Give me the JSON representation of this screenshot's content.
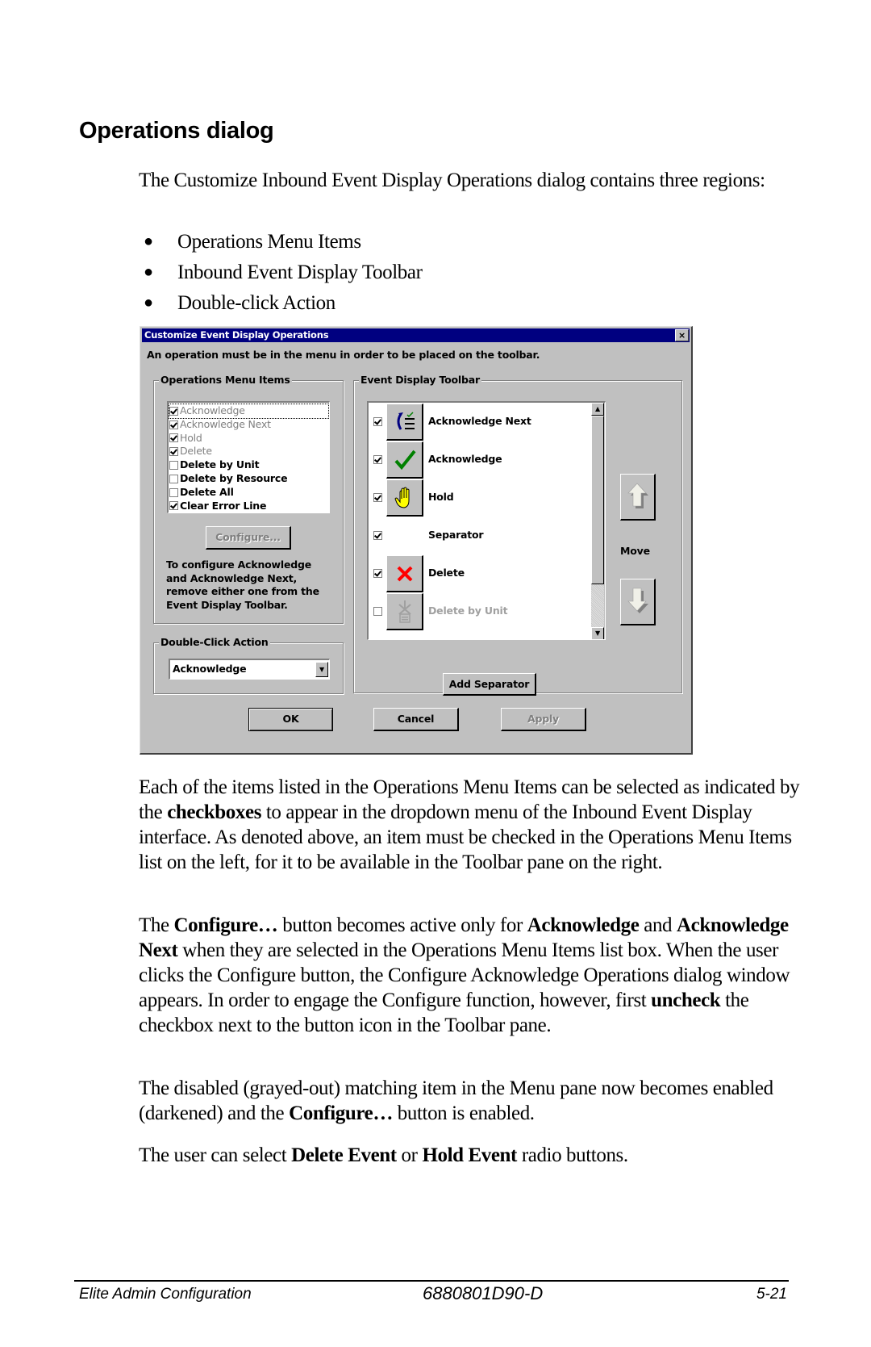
{
  "heading": "Operations dialog",
  "intro": "The Customize Inbound Event Display Operations dialog contains three regions:",
  "bullets": [
    "Operations Menu Items",
    "Inbound Event Display Toolbar",
    "Double-click Action"
  ],
  "dialog": {
    "title": "Customize Event Display Operations",
    "close_label": "×",
    "instruction": "An operation must be in the menu in order to be placed on the toolbar.",
    "menu_group": {
      "label": "Operations Menu Items",
      "items": [
        {
          "label": "Acknowledge",
          "checked": true,
          "grayed": true,
          "focused": true
        },
        {
          "label": "Acknowledge Next",
          "checked": true,
          "grayed": true
        },
        {
          "label": "Hold",
          "checked": true,
          "grayed": true
        },
        {
          "label": "Delete",
          "checked": true,
          "grayed": true
        },
        {
          "label": "Delete by Unit",
          "checked": false,
          "grayed": false
        },
        {
          "label": "Delete by Resource",
          "checked": false,
          "grayed": false
        },
        {
          "label": "Delete All",
          "checked": false,
          "grayed": false
        },
        {
          "label": "Clear Error Line",
          "checked": true,
          "grayed": false
        }
      ],
      "configure_button": "Configure...",
      "configure_enabled": false,
      "note": "To configure Acknowledge and Acknowledge Next, remove either one from the Event Display Toolbar."
    },
    "double_click_group": {
      "label": "Double-Click Action",
      "selected": "Acknowledge"
    },
    "toolbar_group": {
      "label": "Event Display Toolbar",
      "items": [
        {
          "label": "Acknowledge Next",
          "checked": true,
          "icon": "acknowledge-next-icon",
          "disabled": false
        },
        {
          "label": "Acknowledge",
          "checked": true,
          "icon": "green-checkmark-icon",
          "disabled": false
        },
        {
          "label": "Hold",
          "checked": true,
          "icon": "yellow-hand-icon",
          "disabled": false
        },
        {
          "label": "Separator",
          "checked": true,
          "icon": null,
          "disabled": false
        },
        {
          "label": "Delete",
          "checked": true,
          "icon": "red-x-icon",
          "disabled": false
        },
        {
          "label": "Delete by Unit",
          "checked": false,
          "icon": "delete-by-unit-icon",
          "disabled": true
        }
      ],
      "add_separator_button": "Add Separator",
      "move_label": "Move"
    },
    "buttons": {
      "ok": "OK",
      "cancel": "Cancel",
      "apply": "Apply"
    },
    "colors": {
      "titlebar": "#000080",
      "face": "#c0c0c0",
      "check_green": "#008000",
      "delete_red": "#ff0000",
      "hold_yellow": "#ffff00"
    }
  },
  "body": {
    "p1": {
      "t1": "Each of the items listed in the Operations Menu Items can be selected as indicated by the ",
      "b1": "checkboxes",
      "t2": " to appear in the dropdown menu of the Inbound Event Display interface.  As denoted above, an item must be checked in the Operations Menu Items list on the left, for it to be available in the Toolbar pane on the right."
    },
    "p2": {
      "t1": "The ",
      "b1": "Configure…",
      "t2": " button becomes active only for ",
      "b2": "Acknowledge",
      "t3": " and ",
      "b3": "Acknowledge Next",
      "t4": " when they are selected in the Operations Menu Items list box.  When the user clicks the Configure button, the Configure Acknowledge Operations dialog window appears.  In order to engage the Configure function, however, first ",
      "b4": "uncheck",
      "t5": " the checkbox next to the button icon in the Toolbar pane."
    },
    "p3": {
      "t1": "The disabled (grayed-out) matching item in the Menu pane now becomes enabled (darkened) and the ",
      "b1": "Configure…",
      "t2": " button is enabled."
    },
    "p4": {
      "t1": "The user can select ",
      "b1": "Delete Event",
      "t2": " or ",
      "b2": "Hold Event",
      "t3": " radio buttons."
    }
  },
  "footer": {
    "left": "Elite Admin Configuration",
    "center": "6880801D90-D",
    "right": "5-21"
  }
}
